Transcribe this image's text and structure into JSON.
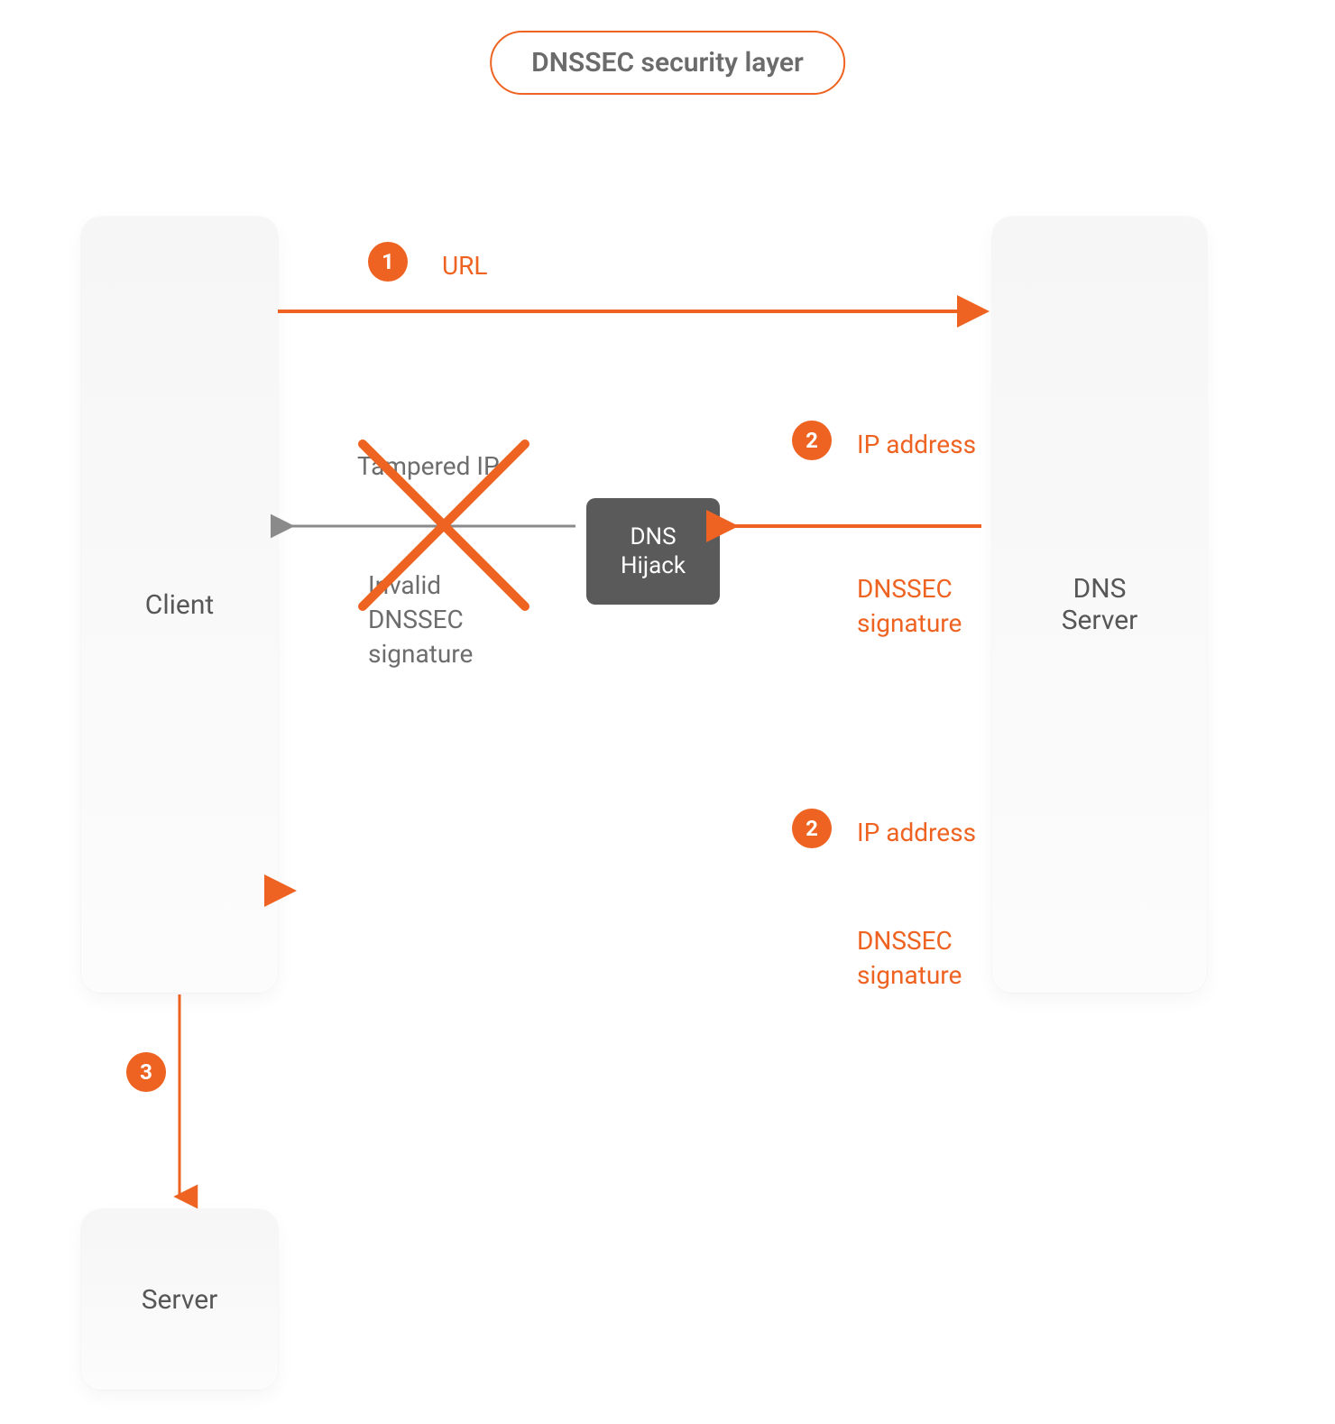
{
  "title": "DNSSEC security layer",
  "nodes": {
    "client": "Client",
    "dns_server": "DNS\nServer",
    "server": "Server",
    "hijack": "DNS\nHijack"
  },
  "steps": {
    "s1": "1",
    "s2a": "2",
    "s2b": "2",
    "s3": "3"
  },
  "labels": {
    "url": "URL",
    "ip_address": "IP address",
    "dnssec_signature": "DNSSEC\nsignature",
    "tampered_ip": "Tampered IP",
    "invalid_signature": "Invalid\nDNSSEC\nsignature"
  },
  "colors": {
    "accent": "#ee6321",
    "node_bg": "#f8f8f8",
    "hijack_bg": "#5a5a5a",
    "text_gray": "#6d6d6d",
    "text_dark": "#575757"
  }
}
